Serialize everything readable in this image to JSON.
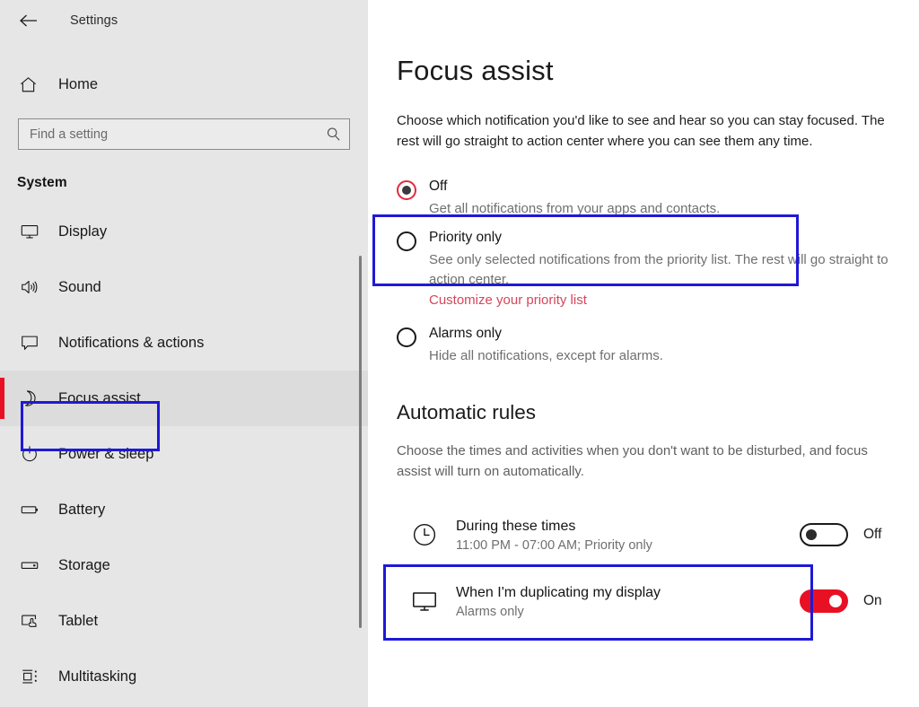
{
  "window": {
    "title": "Settings",
    "back_icon": "back-arrow-icon"
  },
  "sidebar": {
    "home_label": "Home",
    "home_icon": "home-icon",
    "search": {
      "placeholder": "Find a setting",
      "value": "",
      "icon": "search-icon"
    },
    "section_label": "System",
    "items": [
      {
        "label": "Display",
        "icon": "monitor-icon",
        "selected": false
      },
      {
        "label": "Sound",
        "icon": "speaker-icon",
        "selected": false
      },
      {
        "label": "Notifications & actions",
        "icon": "speech-bubble-icon",
        "selected": false
      },
      {
        "label": "Focus assist",
        "icon": "moon-icon",
        "selected": true
      },
      {
        "label": "Power & sleep",
        "icon": "power-icon",
        "selected": false
      },
      {
        "label": "Battery",
        "icon": "battery-icon",
        "selected": false
      },
      {
        "label": "Storage",
        "icon": "storage-icon",
        "selected": false
      },
      {
        "label": "Tablet",
        "icon": "tablet-icon",
        "selected": false
      },
      {
        "label": "Multitasking",
        "icon": "multitasking-icon",
        "selected": false
      }
    ]
  },
  "main": {
    "page_title": "Focus assist",
    "page_description": "Choose which notification you'd like to see and hear so you can stay focused. The rest will go straight to action center where you can see them any time.",
    "radio_options": [
      {
        "label": "Off",
        "description": "Get all notifications from your apps and contacts.",
        "checked": true,
        "link": null
      },
      {
        "label": "Priority only",
        "description": "See only selected notifications from the priority list. The rest will go straight to action center.",
        "checked": false,
        "link": "Customize your priority list"
      },
      {
        "label": "Alarms only",
        "description": "Hide all notifications, except for alarms.",
        "checked": false,
        "link": null
      }
    ],
    "automatic_rules": {
      "title": "Automatic rules",
      "description": "Choose the times and activities when you don't want to be disturbed, and focus assist will turn on automatically.",
      "rules": [
        {
          "title": "During these times",
          "subtitle": "11:00 PM - 07:00 AM; Priority only",
          "icon": "clock-icon",
          "state": "Off",
          "enabled": false
        },
        {
          "title": "When I'm duplicating my display",
          "subtitle": "Alarms only",
          "icon": "monitor-icon",
          "state": "On",
          "enabled": true
        }
      ]
    }
  },
  "colors": {
    "accent_red": "#e81123",
    "link_red": "#d6455a",
    "annotation_blue": "#1f19d6",
    "sidebar_bg": "#e6e6e6",
    "selected_item_bg": "#dcdcdc"
  }
}
